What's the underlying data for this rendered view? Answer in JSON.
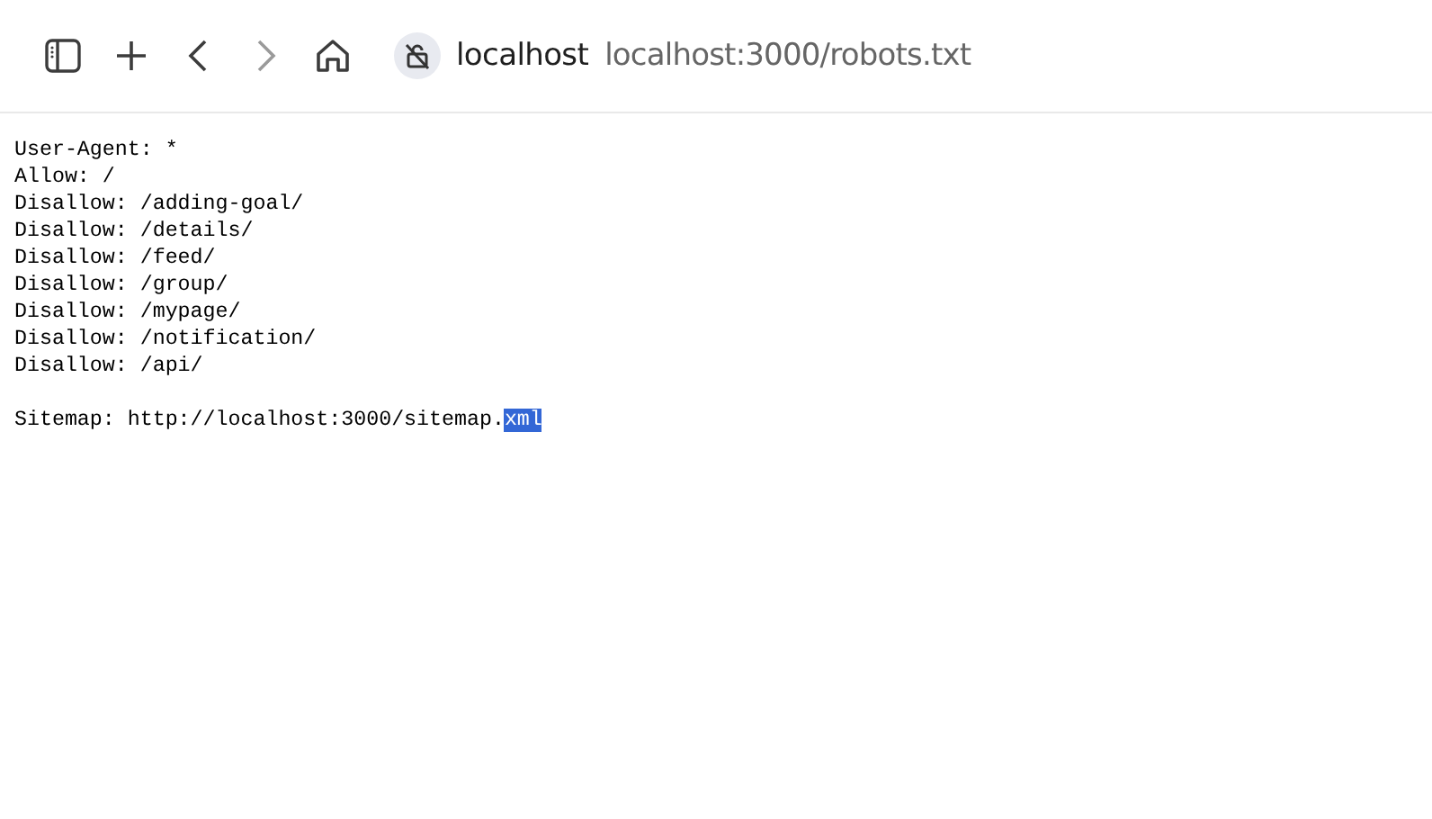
{
  "toolbar": {
    "site_name": "localhost",
    "url": "localhost:3000/robots.txt",
    "forward_disabled": true
  },
  "document": {
    "blocks": [
      [
        {
          "segments": [
            {
              "text": "User-Agent: *",
              "selected": false
            }
          ]
        },
        {
          "segments": [
            {
              "text": "Allow: /",
              "selected": false
            }
          ]
        },
        {
          "segments": [
            {
              "text": "Disallow: /adding-goal/",
              "selected": false
            }
          ]
        },
        {
          "segments": [
            {
              "text": "Disallow: /details/",
              "selected": false
            }
          ]
        },
        {
          "segments": [
            {
              "text": "Disallow: /feed/",
              "selected": false
            }
          ]
        },
        {
          "segments": [
            {
              "text": "Disallow: /group/",
              "selected": false
            }
          ]
        },
        {
          "segments": [
            {
              "text": "Disallow: /mypage/",
              "selected": false
            }
          ]
        },
        {
          "segments": [
            {
              "text": "Disallow: /notification/",
              "selected": false
            }
          ]
        },
        {
          "segments": [
            {
              "text": "Disallow: /api/",
              "selected": false
            }
          ]
        }
      ],
      [
        {
          "segments": [
            {
              "text": "Sitemap: http://localhost:3000/sitemap.",
              "selected": false
            },
            {
              "text": "xml",
              "selected": true
            }
          ]
        }
      ]
    ]
  }
}
